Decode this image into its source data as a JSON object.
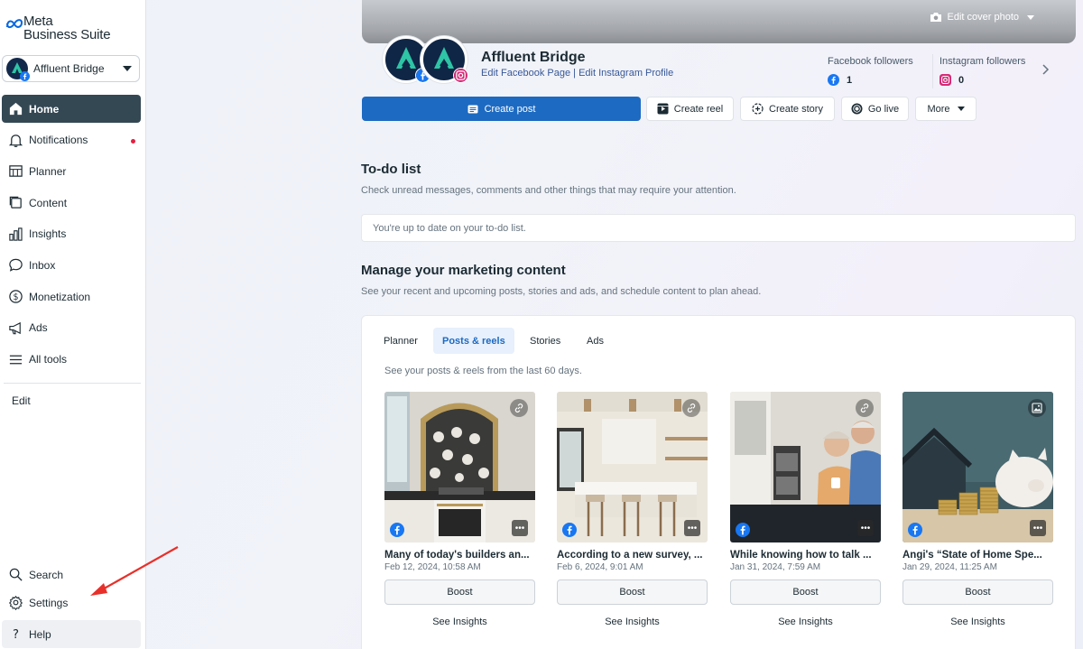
{
  "app": {
    "logo_line1": "Meta",
    "logo_line2": "Business Suite",
    "account_name": "Affluent Bridge"
  },
  "sidebar": {
    "items": [
      {
        "label": "Home",
        "icon": "home-icon",
        "active": true
      },
      {
        "label": "Notifications",
        "icon": "bell-icon",
        "badge": "unread-dot"
      },
      {
        "label": "Planner",
        "icon": "planner-icon"
      },
      {
        "label": "Content",
        "icon": "content-icon"
      },
      {
        "label": "Insights",
        "icon": "insights-icon"
      },
      {
        "label": "Inbox",
        "icon": "inbox-icon"
      },
      {
        "label": "Monetization",
        "icon": "dollar-icon"
      },
      {
        "label": "Ads",
        "icon": "megaphone-icon"
      },
      {
        "label": "All tools",
        "icon": "menu-icon"
      }
    ],
    "edit_label": "Edit",
    "bottom": [
      {
        "label": "Search",
        "icon": "search-icon"
      },
      {
        "label": "Settings",
        "icon": "gear-icon"
      },
      {
        "label": "Help",
        "icon": "help-icon"
      }
    ]
  },
  "header": {
    "edit_cover": "Edit cover photo",
    "page_name": "Affluent Bridge",
    "edit_fb": "Edit Facebook Page",
    "separator": " | ",
    "edit_ig": "Edit Instagram Profile",
    "fb_followers_label": "Facebook followers",
    "fb_followers_count": "1",
    "ig_followers_label": "Instagram followers",
    "ig_followers_count": "0"
  },
  "actions": {
    "create_post": "Create post",
    "create_reel": "Create reel",
    "create_story": "Create story",
    "go_live": "Go live",
    "more": "More"
  },
  "todo": {
    "title": "To-do list",
    "subtitle": "Check unread messages, comments and other things that may require your attention.",
    "status": "You're up to date on your to-do list."
  },
  "marketing": {
    "title": "Manage your marketing content",
    "subtitle": "See your recent and upcoming posts, stories and ads, and schedule content to plan ahead.",
    "tabs": [
      "Planner",
      "Posts & reels",
      "Stories",
      "Ads"
    ],
    "active_tab": "Posts & reels",
    "hint": "See your posts & reels from the last 60 days.",
    "posts": [
      {
        "title": "Many of today's builders an...",
        "date": "Feb 12, 2024, 10:58 AM",
        "boost": "Boost",
        "insights": "See Insights",
        "corner_icon": "link-icon"
      },
      {
        "title": "According to a new survey, ...",
        "date": "Feb 6, 2024, 9:01 AM",
        "boost": "Boost",
        "insights": "See Insights",
        "corner_icon": "link-icon"
      },
      {
        "title": "While knowing how to talk ...",
        "date": "Jan 31, 2024, 7:59 AM",
        "boost": "Boost",
        "insights": "See Insights",
        "corner_icon": "link-icon"
      },
      {
        "title": "Angi's “State of Home Spe...",
        "date": "Jan 29, 2024, 11:25 AM",
        "boost": "Boost",
        "insights": "See Insights",
        "corner_icon": "photo-icon"
      }
    ]
  },
  "colors": {
    "primary": "#1d6ac2",
    "sidebar_active": "#344854",
    "notification_dot": "#e41e3f",
    "annotation_arrow": "#e8302a"
  }
}
